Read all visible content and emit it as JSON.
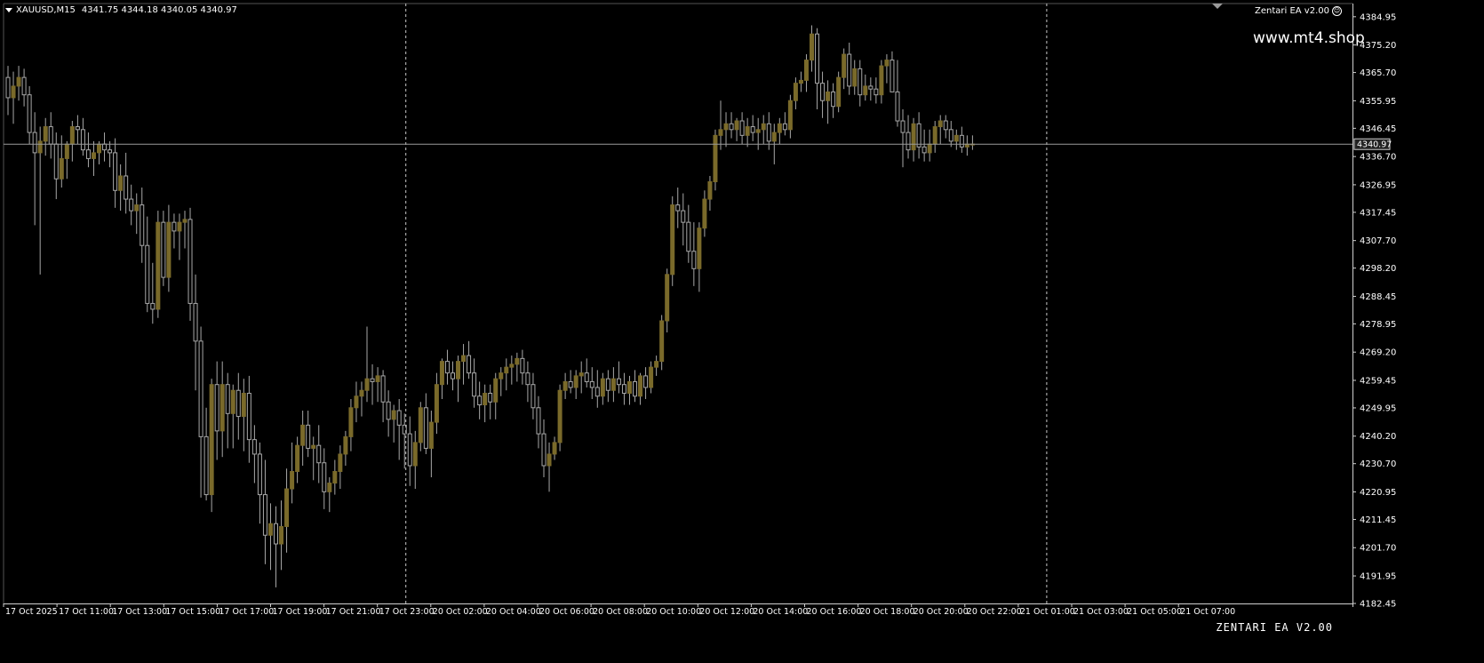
{
  "header": {
    "symbol": "XAUUSD,M15",
    "ohlc": "4341.75 4344.18 4340.05 4340.97"
  },
  "ea_label": "Zentari EA  v2.00",
  "watermark": "www.mt4.shop",
  "brand": "ZENTARI EA V2.00",
  "colors": {
    "background": "#000000",
    "bull": "#7a6a2a",
    "bear": "#000000",
    "wick": "#a8a8a8",
    "grid_vline": "#c8c8c8",
    "price_line": "#9a9a9a",
    "text": "#ffffff"
  },
  "chart_data": {
    "type": "candlestick",
    "ylim": [
      4182.45,
      4389.5
    ],
    "y_ticks": [
      "4384.95",
      "4375.20",
      "4365.70",
      "4355.95",
      "4346.45",
      "4336.70",
      "4326.95",
      "4317.45",
      "4307.70",
      "4298.20",
      "4288.45",
      "4278.95",
      "4269.20",
      "4259.45",
      "4249.95",
      "4240.20",
      "4230.70",
      "4220.95",
      "4211.45",
      "4201.70",
      "4191.95",
      "4182.45"
    ],
    "x_ticks": [
      "17 Oct 2025",
      "17 Oct 11:00",
      "17 Oct 13:00",
      "17 Oct 15:00",
      "17 Oct 17:00",
      "17 Oct 19:00",
      "17 Oct 21:00",
      "17 Oct 23:00",
      "20 Oct 02:00",
      "20 Oct 04:00",
      "20 Oct 06:00",
      "20 Oct 08:00",
      "20 Oct 10:00",
      "20 Oct 12:00",
      "20 Oct 14:00",
      "20 Oct 16:00",
      "20 Oct 18:00",
      "20 Oct 20:00",
      "20 Oct 22:00",
      "21 Oct 01:00",
      "21 Oct 03:00",
      "21 Oct 05:00",
      "21 Oct 07:00"
    ],
    "current_price": "4340.97",
    "current_price_value": 4340.97,
    "separators": [
      "17 Oct 23:00",
      "21 Oct 01:00"
    ],
    "candles": [
      [
        4364,
        4368,
        4351,
        4357
      ],
      [
        4357,
        4366,
        4348,
        4361
      ],
      [
        4361,
        4368,
        4356,
        4364
      ],
      [
        4364,
        4367,
        4354,
        4358
      ],
      [
        4358,
        4361,
        4341,
        4345
      ],
      [
        4345,
        4352,
        4313,
        4338
      ],
      [
        4338,
        4347,
        4296,
        4342
      ],
      [
        4342,
        4350,
        4337,
        4347
      ],
      [
        4347,
        4352,
        4336,
        4341
      ],
      [
        4341,
        4345,
        4322,
        4329
      ],
      [
        4329,
        4344,
        4326,
        4336
      ],
      [
        4336,
        4342,
        4329,
        4341
      ],
      [
        4341,
        4349,
        4335,
        4347
      ],
      [
        4347,
        4351,
        4341,
        4346
      ],
      [
        4346,
        4350,
        4337,
        4339
      ],
      [
        4339,
        4345,
        4333,
        4336
      ],
      [
        4336,
        4342,
        4330,
        4338
      ],
      [
        4338,
        4342,
        4334,
        4341
      ],
      [
        4341,
        4345,
        4335,
        4339
      ],
      [
        4339,
        4342,
        4333,
        4338
      ],
      [
        4338,
        4343,
        4319,
        4325
      ],
      [
        4325,
        4334,
        4318,
        4330
      ],
      [
        4330,
        4338,
        4317,
        4322
      ],
      [
        4322,
        4327,
        4313,
        4318
      ],
      [
        4318,
        4324,
        4310,
        4320
      ],
      [
        4320,
        4326,
        4300,
        4306
      ],
      [
        4306,
        4316,
        4283,
        4286
      ],
      [
        4286,
        4300,
        4279,
        4284
      ],
      [
        4284,
        4318,
        4281,
        4314
      ],
      [
        4314,
        4318,
        4292,
        4295
      ],
      [
        4295,
        4320,
        4290,
        4314
      ],
      [
        4314,
        4317,
        4305,
        4311
      ],
      [
        4311,
        4317,
        4301,
        4314
      ],
      [
        4314,
        4318,
        4305,
        4315
      ],
      [
        4315,
        4319,
        4280,
        4286
      ],
      [
        4286,
        4296,
        4256,
        4273
      ],
      [
        4273,
        4278,
        4219,
        4240
      ],
      [
        4240,
        4250,
        4218,
        4220
      ],
      [
        4220,
        4260,
        4214,
        4258
      ],
      [
        4258,
        4266,
        4232,
        4242
      ],
      [
        4242,
        4266,
        4233,
        4258
      ],
      [
        4258,
        4262,
        4236,
        4248
      ],
      [
        4248,
        4258,
        4236,
        4256
      ],
      [
        4256,
        4262,
        4239,
        4247
      ],
      [
        4247,
        4260,
        4235,
        4255
      ],
      [
        4255,
        4261,
        4231,
        4239
      ],
      [
        4239,
        4244,
        4224,
        4234
      ],
      [
        4234,
        4238,
        4210,
        4220
      ],
      [
        4220,
        4232,
        4196,
        4206
      ],
      [
        4206,
        4217,
        4194,
        4210
      ],
      [
        4210,
        4216,
        4188,
        4203
      ],
      [
        4203,
        4218,
        4194,
        4209
      ],
      [
        4209,
        4229,
        4200,
        4222
      ],
      [
        4222,
        4238,
        4217,
        4228
      ],
      [
        4228,
        4240,
        4224,
        4237
      ],
      [
        4237,
        4249,
        4230,
        4244
      ],
      [
        4244,
        4249,
        4233,
        4236
      ],
      [
        4236,
        4240,
        4225,
        4237
      ],
      [
        4237,
        4244,
        4224,
        4231
      ],
      [
        4231,
        4236,
        4215,
        4221
      ],
      [
        4221,
        4226,
        4214,
        4224
      ],
      [
        4224,
        4232,
        4220,
        4228
      ],
      [
        4228,
        4237,
        4222,
        4234
      ],
      [
        4234,
        4242,
        4230,
        4240
      ],
      [
        4240,
        4253,
        4235,
        4250
      ],
      [
        4250,
        4259,
        4245,
        4254
      ],
      [
        4254,
        4259,
        4247,
        4256
      ],
      [
        4256,
        4278,
        4252,
        4260
      ],
      [
        4260,
        4265,
        4251,
        4259
      ],
      [
        4259,
        4264,
        4252,
        4261
      ],
      [
        4261,
        4263,
        4245,
        4252
      ],
      [
        4252,
        4256,
        4240,
        4246
      ],
      [
        4246,
        4251,
        4238,
        4249
      ],
      [
        4249,
        4253,
        4232,
        4244
      ],
      [
        4244,
        4248,
        4229,
        4241
      ],
      [
        4241,
        4247,
        4223,
        4230
      ],
      [
        4230,
        4242,
        4222,
        4238
      ],
      [
        4238,
        4252,
        4235,
        4250
      ],
      [
        4250,
        4255,
        4234,
        4236
      ],
      [
        4236,
        4249,
        4226,
        4245
      ],
      [
        4245,
        4262,
        4241,
        4258
      ],
      [
        4258,
        4267,
        4253,
        4266
      ],
      [
        4266,
        4270,
        4258,
        4262
      ],
      [
        4262,
        4266,
        4256,
        4260
      ],
      [
        4260,
        4268,
        4252,
        4266
      ],
      [
        4266,
        4272,
        4258,
        4268
      ],
      [
        4268,
        4273,
        4260,
        4262
      ],
      [
        4262,
        4267,
        4250,
        4254
      ],
      [
        4254,
        4259,
        4246,
        4251
      ],
      [
        4251,
        4258,
        4245,
        4255
      ],
      [
        4255,
        4258,
        4246,
        4252
      ],
      [
        4252,
        4262,
        4246,
        4260
      ],
      [
        4260,
        4264,
        4254,
        4262
      ],
      [
        4262,
        4267,
        4256,
        4264
      ],
      [
        4264,
        4268,
        4258,
        4265
      ],
      [
        4265,
        4269,
        4259,
        4267
      ],
      [
        4267,
        4270,
        4258,
        4262
      ],
      [
        4262,
        4266,
        4252,
        4258
      ],
      [
        4258,
        4262,
        4246,
        4250
      ],
      [
        4250,
        4254,
        4236,
        4241
      ],
      [
        4241,
        4246,
        4226,
        4230
      ],
      [
        4230,
        4238,
        4221,
        4234
      ],
      [
        4234,
        4240,
        4232,
        4238
      ],
      [
        4238,
        4258,
        4235,
        4256
      ],
      [
        4256,
        4262,
        4253,
        4259
      ],
      [
        4259,
        4263,
        4255,
        4257
      ],
      [
        4257,
        4263,
        4253,
        4261
      ],
      [
        4261,
        4266,
        4255,
        4262
      ],
      [
        4262,
        4267,
        4257,
        4259
      ],
      [
        4259,
        4264,
        4253,
        4257
      ],
      [
        4257,
        4263,
        4250,
        4254
      ],
      [
        4254,
        4262,
        4251,
        4260
      ],
      [
        4260,
        4263,
        4252,
        4256
      ],
      [
        4256,
        4264,
        4252,
        4260
      ],
      [
        4260,
        4266,
        4255,
        4258
      ],
      [
        4258,
        4262,
        4251,
        4255
      ],
      [
        4255,
        4261,
        4251,
        4259
      ],
      [
        4259,
        4263,
        4252,
        4254
      ],
      [
        4254,
        4262,
        4251,
        4261
      ],
      [
        4261,
        4264,
        4253,
        4257
      ],
      [
        4257,
        4266,
        4255,
        4264
      ],
      [
        4264,
        4268,
        4261,
        4266
      ],
      [
        4266,
        4282,
        4263,
        4280
      ],
      [
        4280,
        4298,
        4276,
        4296
      ],
      [
        4296,
        4323,
        4292,
        4320
      ],
      [
        4320,
        4326,
        4312,
        4318
      ],
      [
        4318,
        4324,
        4306,
        4314
      ],
      [
        4314,
        4320,
        4300,
        4304
      ],
      [
        4304,
        4314,
        4292,
        4298
      ],
      [
        4298,
        4314,
        4290,
        4312
      ],
      [
        4312,
        4325,
        4309,
        4322
      ],
      [
        4322,
        4330,
        4318,
        4328
      ],
      [
        4328,
        4346,
        4325,
        4344
      ],
      [
        4344,
        4356,
        4339,
        4346
      ],
      [
        4346,
        4352,
        4340,
        4348
      ],
      [
        4348,
        4352,
        4343,
        4346
      ],
      [
        4346,
        4350,
        4342,
        4349
      ],
      [
        4349,
        4352,
        4341,
        4344
      ],
      [
        4344,
        4350,
        4340,
        4347
      ],
      [
        4347,
        4351,
        4342,
        4345
      ],
      [
        4345,
        4350,
        4339,
        4346
      ],
      [
        4346,
        4351,
        4341,
        4348
      ],
      [
        4348,
        4352,
        4339,
        4342
      ],
      [
        4342,
        4348,
        4334,
        4345
      ],
      [
        4345,
        4350,
        4341,
        4348
      ],
      [
        4348,
        4352,
        4344,
        4346
      ],
      [
        4346,
        4358,
        4343,
        4356
      ],
      [
        4356,
        4364,
        4353,
        4362
      ],
      [
        4362,
        4366,
        4359,
        4363
      ],
      [
        4363,
        4372,
        4359,
        4370
      ],
      [
        4370,
        4382,
        4366,
        4379
      ],
      [
        4379,
        4381,
        4353,
        4362
      ],
      [
        4362,
        4366,
        4350,
        4356
      ],
      [
        4356,
        4363,
        4348,
        4359
      ],
      [
        4359,
        4362,
        4350,
        4354
      ],
      [
        4354,
        4366,
        4352,
        4364
      ],
      [
        4364,
        4374,
        4360,
        4372
      ],
      [
        4372,
        4376,
        4358,
        4361
      ],
      [
        4361,
        4370,
        4358,
        4367
      ],
      [
        4367,
        4370,
        4354,
        4358
      ],
      [
        4358,
        4365,
        4356,
        4361
      ],
      [
        4361,
        4364,
        4356,
        4360
      ],
      [
        4360,
        4364,
        4355,
        4358
      ],
      [
        4358,
        4370,
        4355,
        4368
      ],
      [
        4368,
        4372,
        4362,
        4370
      ],
      [
        4370,
        4373,
        4359,
        4359
      ],
      [
        4359,
        4370,
        4347,
        4349
      ],
      [
        4349,
        4353,
        4333,
        4345
      ],
      [
        4345,
        4351,
        4336,
        4339
      ],
      [
        4339,
        4350,
        4335,
        4348
      ],
      [
        4348,
        4352,
        4336,
        4340
      ],
      [
        4340,
        4346,
        4335,
        4338
      ],
      [
        4338,
        4346,
        4335,
        4341
      ],
      [
        4341,
        4349,
        4338,
        4347
      ],
      [
        4347,
        4351,
        4341,
        4349
      ],
      [
        4349,
        4351,
        4343,
        4346
      ],
      [
        4346,
        4349,
        4340,
        4342
      ],
      [
        4342,
        4346,
        4339,
        4344
      ],
      [
        4344,
        4347,
        4338,
        4340
      ],
      [
        4340,
        4344,
        4337,
        4341
      ],
      [
        4341,
        4344,
        4339,
        4341
      ]
    ]
  }
}
